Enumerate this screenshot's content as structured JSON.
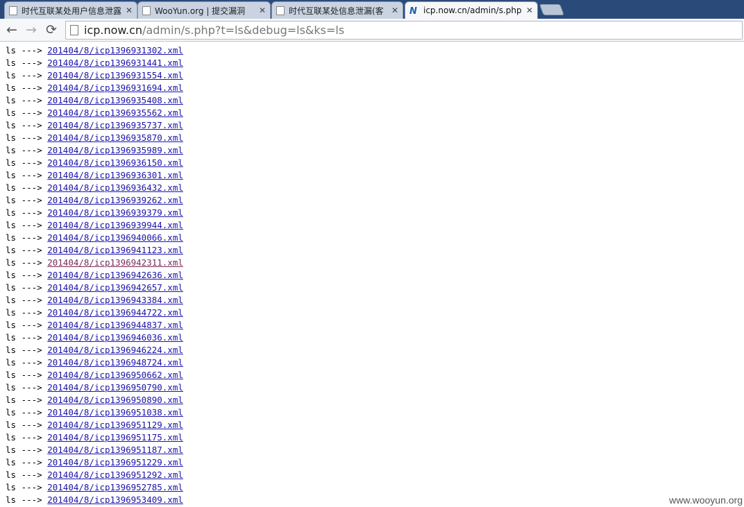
{
  "tabs": [
    {
      "label": "时代互联某处用户信息泄露",
      "active": false
    },
    {
      "label": "WooYun.org | 提交漏洞",
      "active": false
    },
    {
      "label": "时代互联某处信息泄漏(客",
      "active": false
    },
    {
      "label": "icp.now.cn/admin/s.php",
      "active": true
    }
  ],
  "toolbar": {
    "back": "←",
    "forward": "→",
    "reload": "⟳",
    "url_host": "icp.now.cn",
    "url_path": "/admin/s.php?t=ls&debug=ls&ks=ls"
  },
  "listing": {
    "prefix": "ls --->",
    "visited_index": 17,
    "files": [
      "201404/8/icp1396931302.xml",
      "201404/8/icp1396931441.xml",
      "201404/8/icp1396931554.xml",
      "201404/8/icp1396931694.xml",
      "201404/8/icp1396935408.xml",
      "201404/8/icp1396935562.xml",
      "201404/8/icp1396935737.xml",
      "201404/8/icp1396935870.xml",
      "201404/8/icp1396935989.xml",
      "201404/8/icp1396936150.xml",
      "201404/8/icp1396936301.xml",
      "201404/8/icp1396936432.xml",
      "201404/8/icp1396939262.xml",
      "201404/8/icp1396939379.xml",
      "201404/8/icp1396939944.xml",
      "201404/8/icp1396940066.xml",
      "201404/8/icp1396941123.xml",
      "201404/8/icp1396942311.xml",
      "201404/8/icp1396942636.xml",
      "201404/8/icp1396942657.xml",
      "201404/8/icp1396943384.xml",
      "201404/8/icp1396944722.xml",
      "201404/8/icp1396944837.xml",
      "201404/8/icp1396946036.xml",
      "201404/8/icp1396946224.xml",
      "201404/8/icp1396948724.xml",
      "201404/8/icp1396950662.xml",
      "201404/8/icp1396950790.xml",
      "201404/8/icp1396950890.xml",
      "201404/8/icp1396951038.xml",
      "201404/8/icp1396951129.xml",
      "201404/8/icp1396951175.xml",
      "201404/8/icp1396951187.xml",
      "201404/8/icp1396951229.xml",
      "201404/8/icp1396951292.xml",
      "201404/8/icp1396952785.xml",
      "201404/8/icp1396953409.xml"
    ]
  },
  "watermark": "www.wooyun.org"
}
